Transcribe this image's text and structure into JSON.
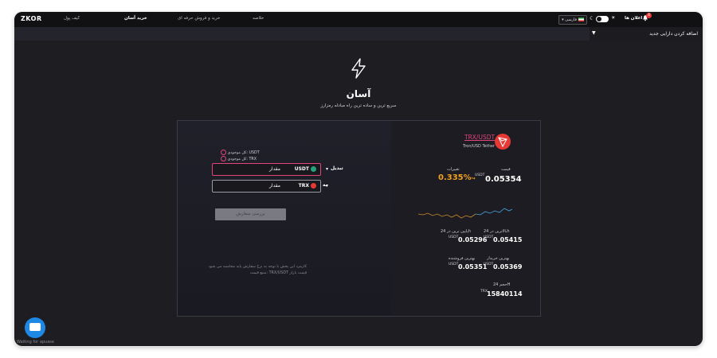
{
  "header": {
    "logo": "ZKOR",
    "nav": [
      "کیف پول",
      "خرید آسان",
      "خرید و فروش حرفه ای",
      "خلاصه"
    ],
    "active_nav": "خرید آسان",
    "language": "فارسی",
    "notifications_label": "اعلان ها",
    "notifications_count": "4"
  },
  "sidebar": {
    "add_asset_label": "اضافه کردن دارایی جدید"
  },
  "hero": {
    "title": "آسان",
    "subtitle": "سریع ترین و ساده ترین راه مبادله رمزارز"
  },
  "exchange": {
    "balance_from": "کل موجودی: USDT",
    "balance_to": "کل موجودی: TRX",
    "from_label": "تبدیل",
    "to_label": "به",
    "from_currency": "USDT",
    "to_currency": "TRX",
    "amount_placeholder": "مقدار",
    "submit_label": "بررسی سفارش",
    "note_line1": "کارمزد این بخش با توجه به نرخ سفارش پایه محاسبه می شود",
    "note_line2": "منبع قیمت: TRX/USDT قیمت بازار"
  },
  "market": {
    "pair": "TRX/USDT",
    "pair_name": "Tron/USD Tether",
    "price_label": "قیمت",
    "change_label": "تغییرات",
    "price": "0.05354",
    "change": "0.335%",
    "unit": "USDT",
    "high_label": "بالاترین در 24h",
    "low_label": "پایین ترین در 24h",
    "high": "0.05415",
    "low": "0.05296",
    "bid_label": "بهترین خریدار",
    "ask_label": "بهترین فروشنده",
    "bid": "0.05351",
    "ask": "0.05369",
    "volume_label": "حجم 24H",
    "volume_unit": "TRX",
    "volume": "15840114",
    "colors": {
      "accent": "#e0457b",
      "change": "#f0a021",
      "tron": "#e53935"
    }
  },
  "chat": {
    "waiting_label": "Waiting for apuase"
  }
}
